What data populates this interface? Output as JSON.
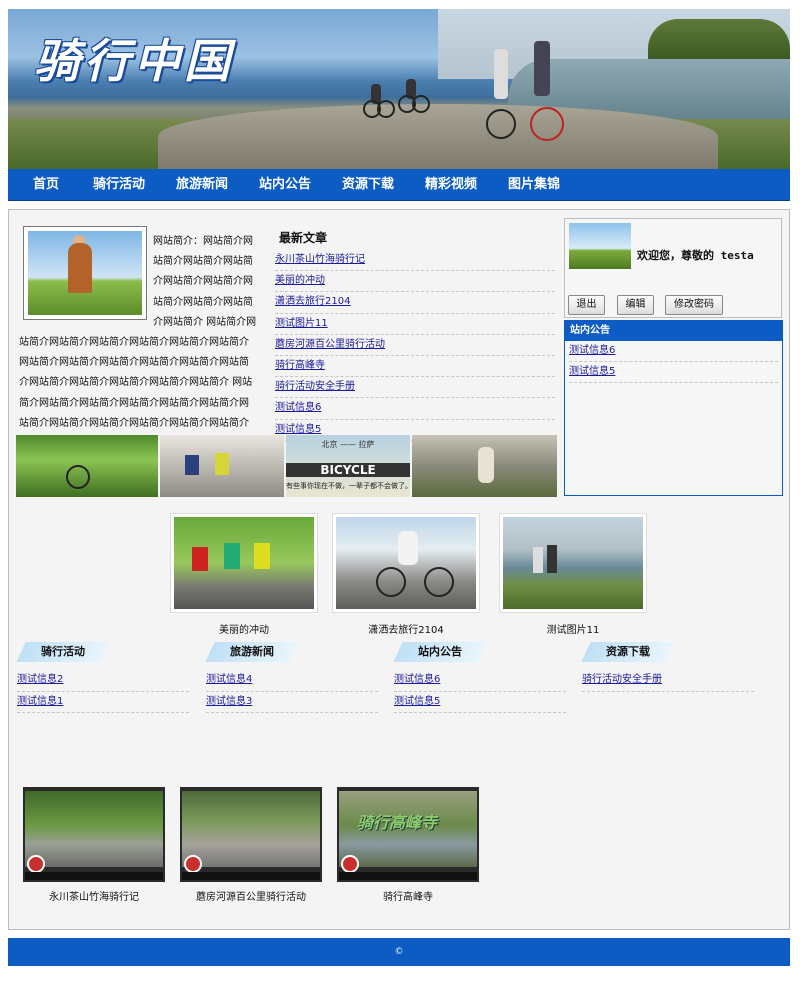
{
  "banner": {
    "logo_text": "骑行中国"
  },
  "nav": {
    "items": [
      "首页",
      "骑行活动",
      "旅游新闻",
      "站内公告",
      "资源下载",
      "精彩视频",
      "图片集锦"
    ]
  },
  "intro": {
    "text": "网站简介：网站简介网站简介网站简介网站简介网站简介网站简介网站简介网站简介网站简介网站简介 网站简介网站简介网站简介网站简介网站简介网站简介网站简介网站简介网站简介网站简介网站简介网站简介网站简介网站简介网站简介网站简介网站简介网站简介 网站简介网站简介网站简介网站简介网站简介网站简介网站简介网站简介网站简介网站简介网站简介网站简介 简介"
  },
  "articles": {
    "title": "最新文章",
    "items": [
      "永川茶山竹海骑行记",
      "美丽的冲动",
      "潇洒去旅行2104",
      "测试图片11",
      "蘑房河源百公里骑行活动",
      "骑行高峰寺",
      "骑行活动安全手册",
      "测试信息6",
      "测试信息5"
    ]
  },
  "user": {
    "welcome": "欢迎您，尊敬的 testa",
    "buttons": [
      "退出",
      "编辑",
      "修改密码"
    ]
  },
  "notice": {
    "title": "站内公告",
    "items": [
      "测试信息6",
      "测试信息5"
    ]
  },
  "strip": {
    "bicycle_title": "BICYCLE",
    "bicycle_top": "北京 —— 拉萨",
    "bicycle_sub": "有些事你现在不做，一辈子都不会做了。"
  },
  "gallery": {
    "items": [
      {
        "caption": "美丽的冲动"
      },
      {
        "caption": "潇洒去旅行2104"
      },
      {
        "caption": "测试图片11"
      }
    ]
  },
  "sections": [
    {
      "title": "骑行活动",
      "items": [
        "测试信息2",
        "测试信息1"
      ]
    },
    {
      "title": "旅游新闻",
      "items": [
        "测试信息4",
        "测试信息3"
      ]
    },
    {
      "title": "站内公告",
      "items": [
        "测试信息6",
        "测试信息5"
      ]
    },
    {
      "title": "资源下载",
      "items": [
        "骑行活动安全手册"
      ]
    }
  ],
  "videos": {
    "items": [
      {
        "caption": "永川茶山竹海骑行记"
      },
      {
        "caption": "蘑房河源百公里骑行活动"
      },
      {
        "caption": "骑行高峰寺",
        "overlay": "骑行高峰寺"
      }
    ]
  },
  "footer": {
    "text": "©"
  },
  "colors": {
    "primary": "#0c5cc4",
    "panel_bg": "#f4f4f4",
    "link": "#1a1a9a"
  }
}
